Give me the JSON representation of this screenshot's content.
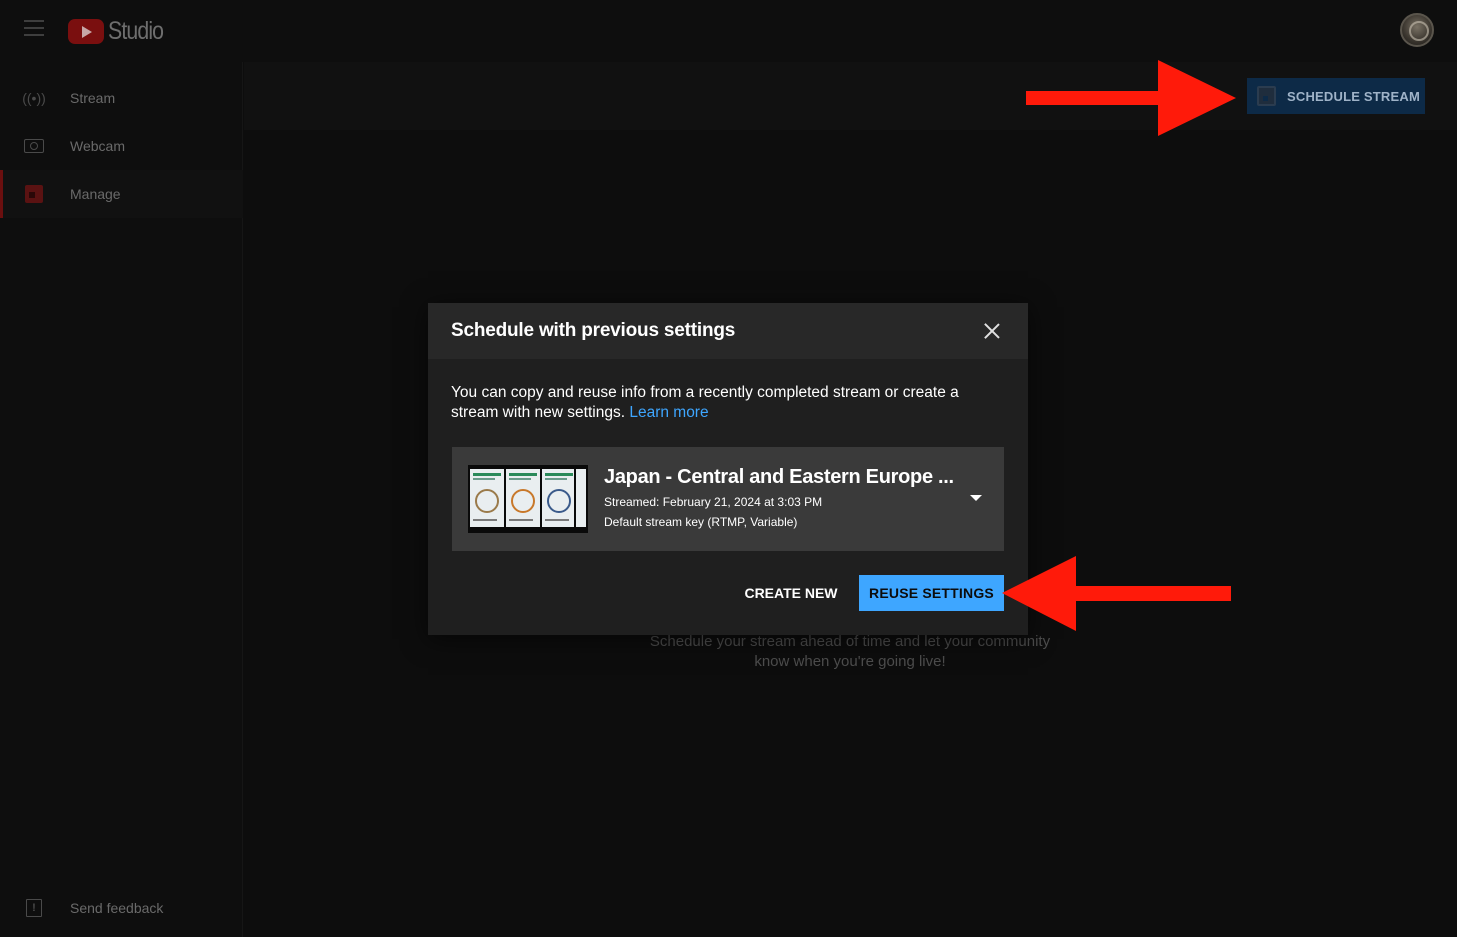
{
  "app": {
    "logo_text": "Studio"
  },
  "sidebar": {
    "items": [
      {
        "label": "Stream",
        "icon": "broadcast-icon"
      },
      {
        "label": "Webcam",
        "icon": "camera-icon"
      },
      {
        "label": "Manage",
        "icon": "calendar-icon"
      }
    ],
    "feedback": {
      "label": "Send feedback",
      "icon": "feedback-icon"
    }
  },
  "header": {
    "schedule_label": "SCHEDULE STREAM"
  },
  "empty_state": {
    "text": "Schedule your stream ahead of time and let your community know when you're going live!"
  },
  "dialog": {
    "title": "Schedule with previous settings",
    "body": "You can copy and reuse info from a recently completed stream or create a stream with new settings.",
    "learn_more": "Learn more",
    "stream": {
      "title": "Japan - Central and Eastern Europe ...",
      "streamed": "Streamed: February 21, 2024 at 3:03 PM",
      "stream_key": "Default stream key (RTMP, Variable)"
    },
    "create_new": "CREATE NEW",
    "reuse_settings": "REUSE SETTINGS"
  },
  "colors": {
    "accent_blue": "#3ea6ff",
    "annotation_arrow": "#ff1a0a",
    "active_red": "#6b0f0f"
  }
}
